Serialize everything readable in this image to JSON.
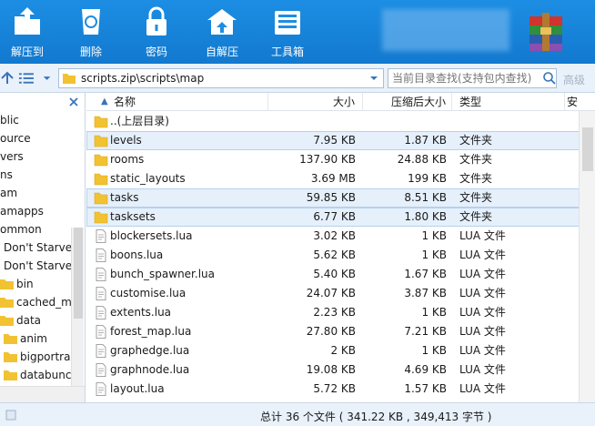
{
  "toolbar": {
    "buttons": [
      {
        "label": "解压到",
        "icon": "extract-folder-icon"
      },
      {
        "label": "删除",
        "icon": "recycle-bin-icon"
      },
      {
        "label": "密码",
        "icon": "lock-icon"
      },
      {
        "label": "自解压",
        "icon": "self-extract-icon"
      },
      {
        "label": "工具箱",
        "icon": "toolbox-icon"
      }
    ]
  },
  "address": {
    "path": "scripts.zip\\scripts\\map",
    "search_placeholder": "当前目录查找(支持包内查找)",
    "advanced": "高级"
  },
  "tree": {
    "items": [
      "blic",
      "ource",
      "vers",
      "ns",
      "am",
      "amapps",
      "ommon",
      "Don't Starve",
      "Don't Starve",
      "bin",
      "cached_mc",
      "data",
      "anim",
      "bigportra",
      "databunc"
    ]
  },
  "columns": {
    "name": "名称",
    "size": "大小",
    "compressed": "压缩后大小",
    "type": "类型",
    "extra": "安"
  },
  "files": [
    {
      "name": "..(上层目录)",
      "size": "",
      "compressed": "",
      "type": "",
      "kind": "folder"
    },
    {
      "name": "levels",
      "size": "7.95 KB",
      "compressed": "1.87 KB",
      "type": "文件夹",
      "kind": "folder"
    },
    {
      "name": "rooms",
      "size": "137.90 KB",
      "compressed": "24.88 KB",
      "type": "文件夹",
      "kind": "folder"
    },
    {
      "name": "static_layouts",
      "size": "3.69 MB",
      "compressed": "199 KB",
      "type": "文件夹",
      "kind": "folder"
    },
    {
      "name": "tasks",
      "size": "59.85 KB",
      "compressed": "8.51 KB",
      "type": "文件夹",
      "kind": "folder"
    },
    {
      "name": "tasksets",
      "size": "6.77 KB",
      "compressed": "1.80 KB",
      "type": "文件夹",
      "kind": "folder"
    },
    {
      "name": "blockersets.lua",
      "size": "3.02 KB",
      "compressed": "1 KB",
      "type": "LUA 文件",
      "kind": "file"
    },
    {
      "name": "boons.lua",
      "size": "5.62 KB",
      "compressed": "1 KB",
      "type": "LUA 文件",
      "kind": "file"
    },
    {
      "name": "bunch_spawner.lua",
      "size": "5.40 KB",
      "compressed": "1.67 KB",
      "type": "LUA 文件",
      "kind": "file"
    },
    {
      "name": "customise.lua",
      "size": "24.07 KB",
      "compressed": "3.87 KB",
      "type": "LUA 文件",
      "kind": "file"
    },
    {
      "name": "extents.lua",
      "size": "2.23 KB",
      "compressed": "1 KB",
      "type": "LUA 文件",
      "kind": "file"
    },
    {
      "name": "forest_map.lua",
      "size": "27.80 KB",
      "compressed": "7.21 KB",
      "type": "LUA 文件",
      "kind": "file"
    },
    {
      "name": "graphedge.lua",
      "size": "2 KB",
      "compressed": "1 KB",
      "type": "LUA 文件",
      "kind": "file"
    },
    {
      "name": "graphnode.lua",
      "size": "19.08 KB",
      "compressed": "4.69 KB",
      "type": "LUA 文件",
      "kind": "file"
    },
    {
      "name": "layout.lua",
      "size": "5.72 KB",
      "compressed": "1.57 KB",
      "type": "LUA 文件",
      "kind": "file"
    }
  ],
  "status": {
    "summary": "总计 36 个文件 ( 341.22 KB , 349,413 字节 )"
  },
  "colors": {
    "toolbar": "#1c8ee3",
    "selected_row": "#e5f0fb",
    "folder": "#f1c232"
  }
}
